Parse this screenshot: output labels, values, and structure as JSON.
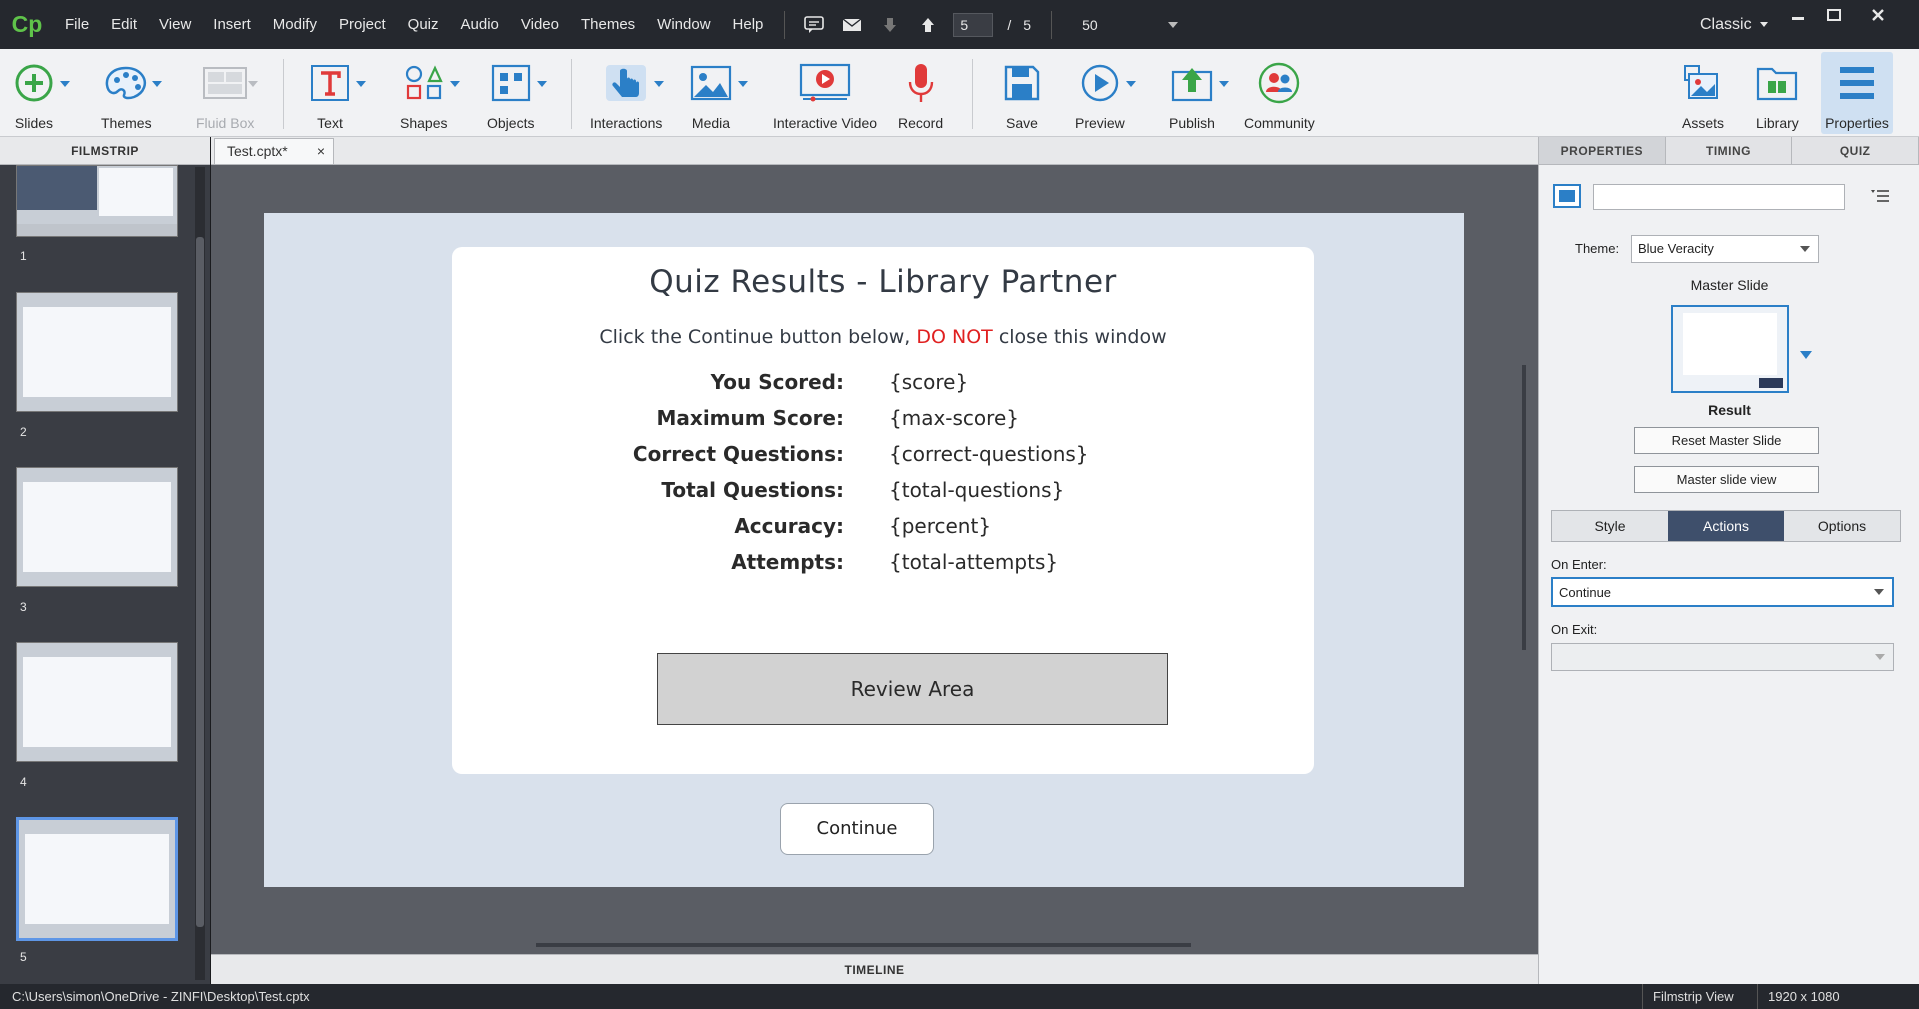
{
  "app": {
    "logo": "Cp",
    "layout_mode": "Classic"
  },
  "menu": [
    "File",
    "Edit",
    "View",
    "Insert",
    "Modify",
    "Project",
    "Quiz",
    "Audio",
    "Video",
    "Themes",
    "Window",
    "Help"
  ],
  "nav": {
    "current_slide": "5",
    "separator": "/",
    "total_slides": "5",
    "zoom": "50"
  },
  "toolbar": {
    "slides": "Slides",
    "themes": "Themes",
    "fluid_box": "Fluid Box",
    "text": "Text",
    "shapes": "Shapes",
    "objects": "Objects",
    "interactions": "Interactions",
    "media": "Media",
    "interactive_video": "Interactive Video",
    "record": "Record",
    "save": "Save",
    "preview": "Preview",
    "publish": "Publish",
    "community": "Community",
    "assets": "Assets",
    "library": "Library",
    "properties": "Properties"
  },
  "filmstrip": {
    "header": "FILMSTRIP",
    "slides": [
      "1",
      "2",
      "3",
      "4",
      "5"
    ],
    "selected": "5"
  },
  "document": {
    "tab_label": "Test.cptx*",
    "close": "×"
  },
  "slide": {
    "title": "Quiz Results - Library Partner",
    "subtitle_pre": "Click the Continue button below, ",
    "subtitle_warn": "DO NOT",
    "subtitle_post": " close this window",
    "results": [
      {
        "label": "You Scored:",
        "value": "{score}"
      },
      {
        "label": "Maximum Score:",
        "value": "{max-score}"
      },
      {
        "label": "Correct Questions:",
        "value": "{correct-questions}"
      },
      {
        "label": "Total Questions:",
        "value": "{total-questions}"
      },
      {
        "label": "Accuracy:",
        "value": "{percent}"
      },
      {
        "label": "Attempts:",
        "value": "{total-attempts}"
      }
    ],
    "review_area": "Review Area",
    "continue": "Continue"
  },
  "timeline": {
    "label": "TIMELINE"
  },
  "properties": {
    "tabs": [
      "PROPERTIES",
      "TIMING",
      "QUIZ"
    ],
    "active_tab": "PROPERTIES",
    "name_value": "",
    "theme_label": "Theme:",
    "theme_value": "Blue Veracity",
    "master_slide_label": "Master Slide",
    "master_name": "Result",
    "reset_master": "Reset Master Slide",
    "master_view": "Master slide view",
    "sub_tabs": [
      "Style",
      "Actions",
      "Options"
    ],
    "active_sub_tab": "Actions",
    "on_enter_label": "On Enter:",
    "on_enter_value": "Continue",
    "on_exit_label": "On Exit:",
    "on_exit_value": ""
  },
  "statusbar": {
    "path": "C:\\Users\\simon\\OneDrive - ZINFI\\Desktop\\Test.cptx",
    "view": "Filmstrip View",
    "resolution": "1920 x 1080"
  },
  "colors": {
    "accent": "#2b7fc7",
    "warning": "#e02020",
    "selected_thumb": "#5e96e6",
    "active_segment": "#3e4f6b"
  }
}
